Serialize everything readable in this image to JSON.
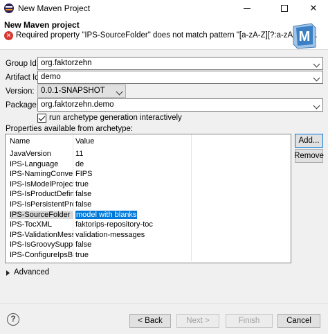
{
  "window": {
    "title": "New Maven Project",
    "minimize_icon": "minimize-icon",
    "maximize_icon": "maximize-icon",
    "close_glyph": "✕"
  },
  "header": {
    "title": "New Maven project",
    "error_message": "Required property \"IPS-SourceFolder\" does not match pattern \"[a-zA-Z][?:a-zA-Z\\d]*\".",
    "banner_letter": "M"
  },
  "form": {
    "group_id_label": "Group Id:",
    "group_id_value": "org.faktorzehn",
    "artifact_id_label": "Artifact Id:",
    "artifact_id_value": "demo",
    "version_label": "Version:",
    "version_value": "0.0.1-SNAPSHOT",
    "package_label": "Package:",
    "package_value": "org.faktorzehn.demo",
    "run_interactive_label": "run archetype generation interactively",
    "properties_label": "Properties available from archetype:"
  },
  "table": {
    "col_name": "Name",
    "col_value": "Value",
    "rows": [
      {
        "name": "JavaVersion",
        "value": "11"
      },
      {
        "name": "IPS-Language",
        "value": "de"
      },
      {
        "name": "IPS-NamingConvent...",
        "value": "FIPS"
      },
      {
        "name": "IPS-IsModelProject",
        "value": "true"
      },
      {
        "name": "IPS-IsProductDefiniti...",
        "value": "false"
      },
      {
        "name": "IPS-IsPersistentProject",
        "value": "false"
      },
      {
        "name": "IPS-SourceFolder",
        "value": "model with blanks"
      },
      {
        "name": "IPS-TocXML",
        "value": "faktorips-repository-toc"
      },
      {
        "name": "IPS-ValidationMessa...",
        "value": "validation-messages"
      },
      {
        "name": "IPS-IsGroovySupport",
        "value": "false"
      },
      {
        "name": "IPS-ConfigureIpsBuild",
        "value": "true"
      }
    ]
  },
  "buttons": {
    "add": "Add...",
    "remove": "Remove",
    "back": "< Back",
    "next": "Next >",
    "finish": "Finish",
    "cancel": "Cancel",
    "help": "?"
  },
  "advanced": {
    "label": "Advanced"
  },
  "colors": {
    "selection": "#0078d7",
    "error": "#d63a32",
    "banner": "#3b7fc4"
  }
}
